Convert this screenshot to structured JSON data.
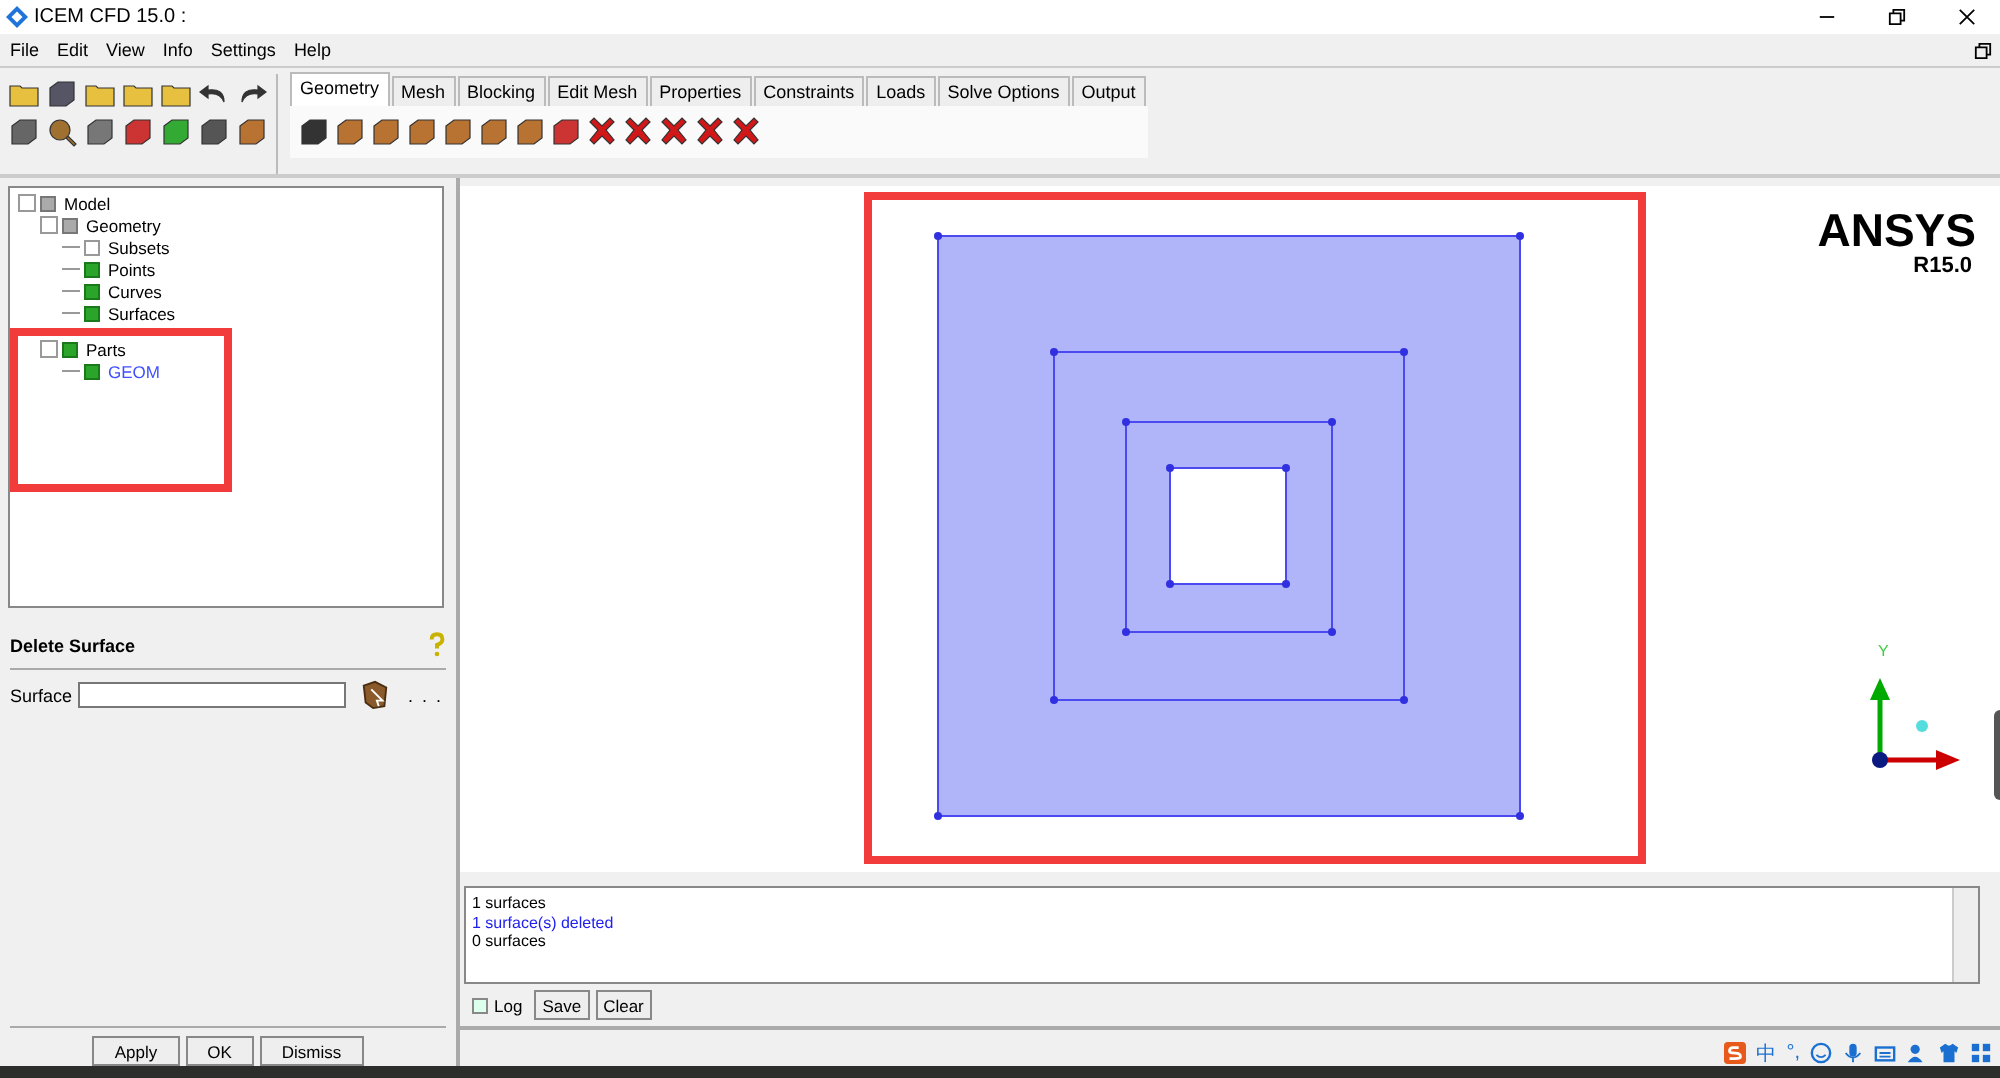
{
  "window": {
    "title": "ICEM CFD 15.0 :"
  },
  "menu": [
    "File",
    "Edit",
    "View",
    "Info",
    "Settings",
    "Help"
  ],
  "tabs": [
    {
      "label": "Geometry",
      "selected": true
    },
    {
      "label": "Mesh",
      "selected": false
    },
    {
      "label": "Blocking",
      "selected": false
    },
    {
      "label": "Edit Mesh",
      "selected": false
    },
    {
      "label": "Properties",
      "selected": false
    },
    {
      "label": "Constraints",
      "selected": false
    },
    {
      "label": "Loads",
      "selected": false
    },
    {
      "label": "Solve Options",
      "selected": false
    },
    {
      "label": "Output",
      "selected": false
    }
  ],
  "tree": [
    {
      "label": "Model",
      "checked": true,
      "partial": true,
      "expanded": true,
      "children": [
        {
          "label": "Geometry",
          "checked": true,
          "partial": true,
          "expanded": true,
          "children": [
            {
              "label": "Subsets",
              "checked": false
            },
            {
              "label": "Points",
              "checked": true
            },
            {
              "label": "Curves",
              "checked": true
            },
            {
              "label": "Surfaces",
              "checked": true
            }
          ]
        },
        {
          "label": "Parts",
          "checked": true,
          "expanded": true,
          "children": [
            {
              "label": "GEOM",
              "checked": true,
              "color": "#4050ff"
            }
          ]
        }
      ]
    }
  ],
  "panel": {
    "title": "Delete Surface",
    "field_label": "Surface",
    "more": ". . .",
    "buttons": [
      "Apply",
      "OK",
      "Dismiss"
    ]
  },
  "viewport": {
    "logo": "ANSYS",
    "version": "R15.0",
    "axis_label": "Y"
  },
  "messages": [
    {
      "text": "1 surfaces",
      "kind": "info"
    },
    {
      "text": "1 surface(s) deleted",
      "kind": "success"
    },
    {
      "text": "0 surfaces",
      "kind": "info"
    }
  ],
  "log": {
    "label": "Log",
    "checked": false,
    "buttons": [
      "Save",
      "Clear"
    ]
  },
  "taskbar": {
    "ime": "中",
    "punct": "°,"
  }
}
